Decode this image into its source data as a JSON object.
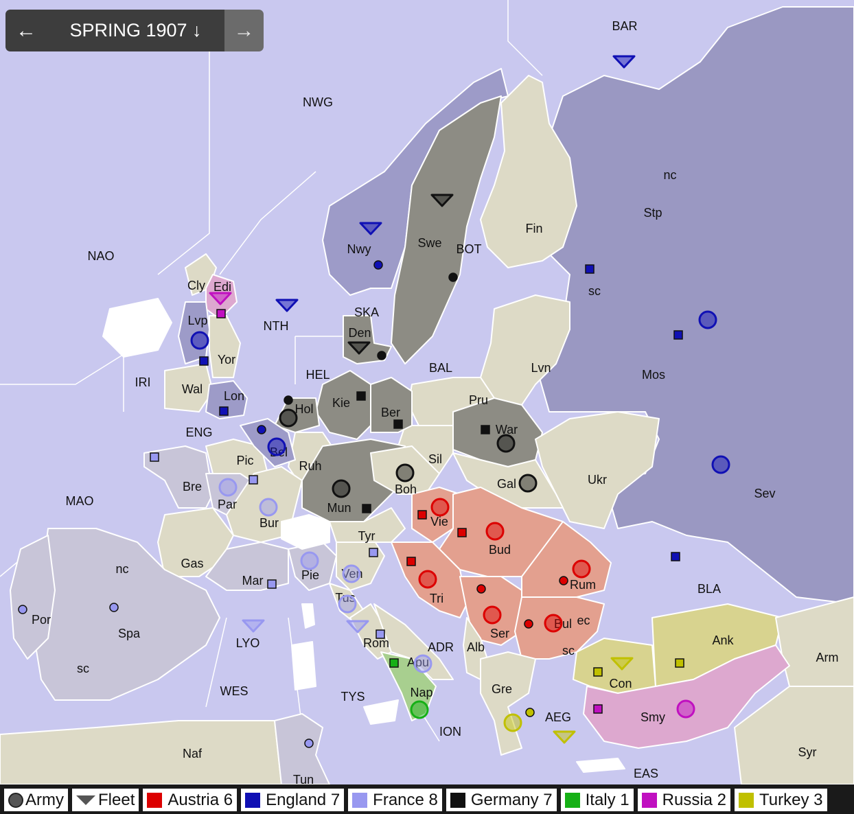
{
  "nav": {
    "prev_icon": "←",
    "phase": "SPRING 1907 ↓",
    "next_icon": "→"
  },
  "colors": {
    "sea": "#c9c8ef",
    "neutral": "#dddac6",
    "austria": "#dc0000",
    "austria_land": "#e3a08f",
    "england": "#1010b4",
    "england_land": "#9d9bc8",
    "france": "#9898f0",
    "france_land": "#c8c5d8",
    "germany": "#111111",
    "germany_land": "#8d8c84",
    "italy": "#16b016",
    "italy_land": "#a8cf8f",
    "russia": "#c010c0",
    "russia_land": "#9a98c2",
    "turkey": "#c0c000",
    "turkey_land": "#d8d38f"
  },
  "labels": [
    {
      "t": "BAR"
    },
    {
      "t": "NWG"
    },
    {
      "t": "nc"
    },
    {
      "t": "Stp"
    },
    {
      "t": "Fin"
    },
    {
      "t": "Swe"
    },
    {
      "t": "BOT"
    },
    {
      "t": "Nwy"
    },
    {
      "t": "NAO"
    },
    {
      "t": "Cly"
    },
    {
      "t": "Edi"
    },
    {
      "t": "Lvp"
    },
    {
      "t": "NTH"
    },
    {
      "t": "SKA"
    },
    {
      "t": "Den"
    },
    {
      "t": "sc"
    },
    {
      "t": "Yor"
    },
    {
      "t": "IRI"
    },
    {
      "t": "Wal"
    },
    {
      "t": "HEL"
    },
    {
      "t": "BAL"
    },
    {
      "t": "Lvn"
    },
    {
      "t": "Mos"
    },
    {
      "t": "Lon"
    },
    {
      "t": "Kie"
    },
    {
      "t": "Ber"
    },
    {
      "t": "Pru"
    },
    {
      "t": "Hol"
    },
    {
      "t": "ENG"
    },
    {
      "t": "War"
    },
    {
      "t": "Bel"
    },
    {
      "t": "Pic"
    },
    {
      "t": "Ruh"
    },
    {
      "t": "Sil"
    },
    {
      "t": "Ukr"
    },
    {
      "t": "Bre"
    },
    {
      "t": "Boh"
    },
    {
      "t": "Gal"
    },
    {
      "t": "Sev"
    },
    {
      "t": "MAO"
    },
    {
      "t": "Par"
    },
    {
      "t": "Mun"
    },
    {
      "t": "Vie"
    },
    {
      "t": "Bur"
    },
    {
      "t": "Tyr"
    },
    {
      "t": "Bud"
    },
    {
      "t": "Gas"
    },
    {
      "t": "nc"
    },
    {
      "t": "Ven"
    },
    {
      "t": "Mar"
    },
    {
      "t": "Pie"
    },
    {
      "t": "Tri"
    },
    {
      "t": "Rum"
    },
    {
      "t": "BLA"
    },
    {
      "t": "Tus"
    },
    {
      "t": "Ser"
    },
    {
      "t": "Por"
    },
    {
      "t": "Spa"
    },
    {
      "t": "Bul"
    },
    {
      "t": "ec"
    },
    {
      "t": "LYO"
    },
    {
      "t": "Rom"
    },
    {
      "t": "ADR"
    },
    {
      "t": "Alb"
    },
    {
      "t": "sc"
    },
    {
      "t": "Ank"
    },
    {
      "t": "Arm"
    },
    {
      "t": "sc"
    },
    {
      "t": "Apu"
    },
    {
      "t": "Con"
    },
    {
      "t": "Gre"
    },
    {
      "t": "Nap"
    },
    {
      "t": "WES"
    },
    {
      "t": "TYS"
    },
    {
      "t": "AEG"
    },
    {
      "t": "Smy"
    },
    {
      "t": "ION"
    },
    {
      "t": "Naf"
    },
    {
      "t": "Syr"
    },
    {
      "t": "EAS"
    },
    {
      "t": "Tun"
    }
  ],
  "units": [
    {
      "power": "england",
      "type": "fleet",
      "province": "BAR"
    },
    {
      "power": "england",
      "type": "fleet",
      "province": "Nwy"
    },
    {
      "power": "england",
      "type": "fleet",
      "province": "NTH"
    },
    {
      "power": "england",
      "type": "army",
      "province": "Lvp"
    },
    {
      "power": "england",
      "type": "army",
      "province": "Bel"
    },
    {
      "power": "england",
      "type": "army",
      "province": "Mos"
    },
    {
      "power": "england",
      "type": "army",
      "province": "Sev"
    },
    {
      "power": "germany",
      "type": "fleet",
      "province": "Swe"
    },
    {
      "power": "germany",
      "type": "fleet",
      "province": "Den"
    },
    {
      "power": "germany",
      "type": "army",
      "province": "Hol"
    },
    {
      "power": "germany",
      "type": "army",
      "province": "Mun"
    },
    {
      "power": "germany",
      "type": "army",
      "province": "Boh"
    },
    {
      "power": "germany",
      "type": "army",
      "province": "War"
    },
    {
      "power": "germany",
      "type": "army",
      "province": "Gal"
    },
    {
      "power": "russia",
      "type": "fleet",
      "province": "Edi"
    },
    {
      "power": "russia",
      "type": "army",
      "province": "Smy"
    },
    {
      "power": "france",
      "type": "army",
      "province": "Par"
    },
    {
      "power": "france",
      "type": "army",
      "province": "Bur"
    },
    {
      "power": "france",
      "type": "army",
      "province": "Pie"
    },
    {
      "power": "france",
      "type": "army",
      "province": "Ven"
    },
    {
      "power": "france",
      "type": "army",
      "province": "Tus"
    },
    {
      "power": "france",
      "type": "army",
      "province": "Apu"
    },
    {
      "power": "france",
      "type": "fleet",
      "province": "LYO"
    },
    {
      "power": "france",
      "type": "fleet",
      "province": "Rom"
    },
    {
      "power": "austria",
      "type": "army",
      "province": "Vie"
    },
    {
      "power": "austria",
      "type": "army",
      "province": "Bud"
    },
    {
      "power": "austria",
      "type": "army",
      "province": "Tri"
    },
    {
      "power": "austria",
      "type": "army",
      "province": "Ser"
    },
    {
      "power": "austria",
      "type": "army",
      "province": "Rum"
    },
    {
      "power": "austria",
      "type": "army",
      "province": "Bul"
    },
    {
      "power": "italy",
      "type": "army",
      "province": "Nap"
    },
    {
      "power": "turkey",
      "type": "army",
      "province": "Gre"
    },
    {
      "power": "turkey",
      "type": "fleet",
      "province": "Con"
    },
    {
      "power": "turkey",
      "type": "fleet",
      "province": "AEG"
    }
  ],
  "legend": [
    {
      "name": "Army",
      "icon": "army-icon"
    },
    {
      "name": "Fleet",
      "icon": "fleet-icon"
    },
    {
      "name": "Austria 6",
      "color": "#dc0000"
    },
    {
      "name": "England 7",
      "color": "#1010b4"
    },
    {
      "name": "France 8",
      "color": "#9898f0"
    },
    {
      "name": "Germany 7",
      "color": "#111111"
    },
    {
      "name": "Italy 1",
      "color": "#16b016"
    },
    {
      "name": "Russia 2",
      "color": "#c010c0"
    },
    {
      "name": "Turkey 3",
      "color": "#c0c000"
    }
  ]
}
